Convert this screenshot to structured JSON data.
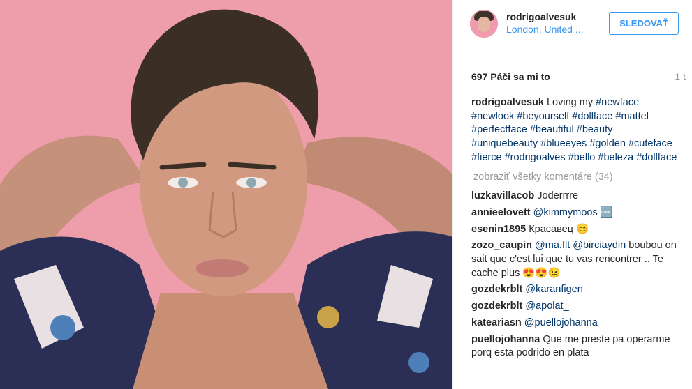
{
  "profile": {
    "username": "rodrigoalvesuk",
    "location": "London, United ...",
    "follow_label": "SLEDOVAŤ"
  },
  "post": {
    "likes": "697 Páči sa mi to",
    "time": "1 t"
  },
  "caption": {
    "user": "rodrigoalvesuk",
    "text": "Loving my",
    "tags": [
      "#newface",
      "#newlook",
      "#beyourself",
      "#dollface",
      "#mattel",
      "#perfectface",
      "#beautiful",
      "#beauty",
      "#uniquebeauty",
      "#blueeyes",
      "#golden",
      "#cuteface",
      "#fierce",
      "#rodrigoalves",
      "#bello",
      "#beleza",
      "#dollface"
    ]
  },
  "view_all": "zobraziť všetky komentáre (34)",
  "comments": [
    {
      "user": "luzkavillacob",
      "text": "Joderrrre"
    },
    {
      "user": "annieelovett",
      "mention": "@kimmymoos",
      "text": "🆒"
    },
    {
      "user": "esenin1895",
      "text": "Красавец 😊"
    },
    {
      "user": "zozo_caupin",
      "mention": "@ma.flt @birciaydin",
      "text": "boubou on sait que c'est lui que tu vas rencontrer .. Te cache plus 😍😍😉"
    },
    {
      "user": "gozdekrblt",
      "mention": "@karanfigen",
      "text": ""
    },
    {
      "user": "gozdekrblt",
      "mention": "@apolat_",
      "text": ""
    },
    {
      "user": "katearіasn",
      "mention": "@puellojohanna",
      "text": ""
    },
    {
      "user": "puellojohanna",
      "text": "Que me preste pa operarme porq esta podrido en plata"
    }
  ],
  "colors": {
    "accent": "#3897f0",
    "tag": "#003569",
    "background_photo": "#ec9aa7"
  }
}
